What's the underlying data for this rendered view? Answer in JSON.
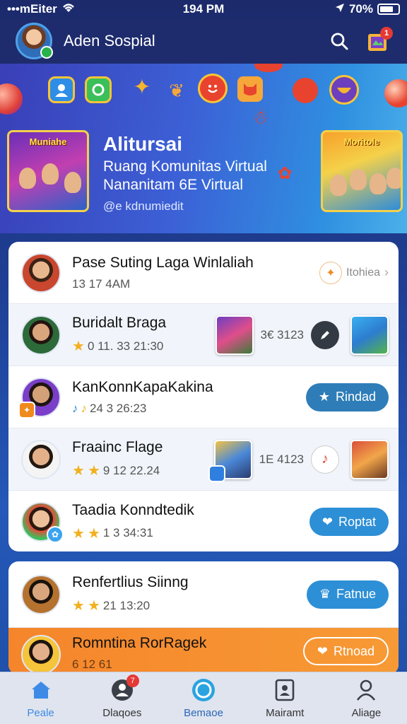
{
  "status_bar": {
    "carrier": "•••mEiter",
    "time": "194 PM",
    "battery": "70%"
  },
  "header": {
    "title": "Aden Sospial",
    "notification_count": "1"
  },
  "banner": {
    "title": "Alitursai",
    "line1": "Ruang Komunitas Virtual",
    "line2": "Nananitam 6E Virtual",
    "tag": "@e kdnumiedit",
    "poster_left_label": "Muniahe",
    "poster_right_label": "Moritole"
  },
  "rows": [
    {
      "name": "Pase Suting Laga Winlaliah",
      "meta": "13 17 4AM",
      "action_label": "Itohiea"
    },
    {
      "name": "Buridalt Braga",
      "meta": "0 11. 33 21:30",
      "side_time": "3€ 3123"
    },
    {
      "name": "KanKonnKapaKakina",
      "meta": "24 3 26:23",
      "action_label": "Rindad"
    },
    {
      "name": "Fraainc Flage",
      "meta": "9   12 22.24",
      "side_time": "1E 4123"
    },
    {
      "name": "Taadia Konndtedik",
      "meta": "1 3 34:31",
      "action_label": "Roptat"
    },
    {
      "name": "Renfertlius Siinng",
      "meta": "21 13:20",
      "action_label": "Fatnue"
    },
    {
      "name": "Romntina RorRagek",
      "meta": "6 12 61",
      "action_label": "Rtnoad"
    }
  ],
  "tabs": [
    {
      "label": "Peale",
      "badge": ""
    },
    {
      "label": "Dlaqoes",
      "badge": "7"
    },
    {
      "label": "Bemaoe",
      "badge": ""
    },
    {
      "label": "Mairamt",
      "badge": ""
    },
    {
      "label": "Aliage",
      "badge": ""
    }
  ],
  "colors": {
    "accent": "#2d8fd6",
    "header_bg": "#1e2c6d",
    "orange_row": "#f5852b",
    "active_tab": "#3d8be6"
  }
}
